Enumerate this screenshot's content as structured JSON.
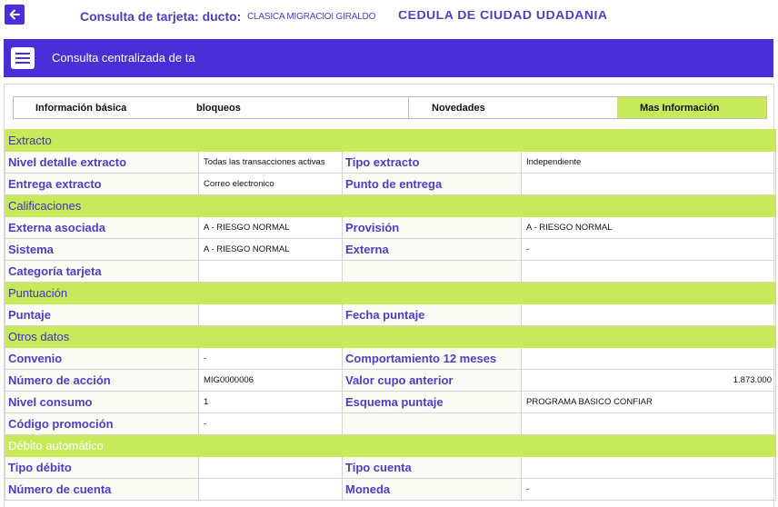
{
  "topbar": {
    "title": "Consulta de tarjeta: ducto:",
    "product": "CLASICA MIGRACIOI GIRALDO",
    "document": "CEDULA DE CIUDAD UDADANIA"
  },
  "banner": {
    "title": "Consulta centralizada de ta"
  },
  "tabs": {
    "basic": "Información básica",
    "bloqueos": "bloqueos",
    "novedades": "Novedades",
    "mas": "Mas Información",
    "active_color": "#c8ea5a"
  },
  "colors": {
    "accent": "#4a2fd6",
    "section": "#c8ea5a",
    "label": "#4a3fc8"
  },
  "sections": {
    "extracto": {
      "title": "Extracto",
      "nivel_label": "Nivel detalle extracto",
      "nivel_value": "Todas las transacciones activas",
      "tipo_label": "Tipo extracto",
      "tipo_value": "Independiente",
      "entrega_label": "Entrega extracto",
      "entrega_value": "Correo electronico",
      "punto_label": "Punto de entrega",
      "punto_value": ""
    },
    "calificaciones": {
      "title": "Calificaciones",
      "externa_asoc_label": "Externa asociada",
      "externa_asoc_value": "A - RIESGO NORMAL",
      "provision_label": "Provisión",
      "provision_value": "A - RIESGO NORMAL",
      "sistema_label": "Sistema",
      "sistema_value": "A - RIESGO NORMAL",
      "externa_label": "Externa",
      "externa_value": "-",
      "categoria_label": "Categoría tarjeta",
      "categoria_value": ""
    },
    "puntuacion": {
      "title": "Puntuación",
      "puntaje_label": "Puntaje",
      "puntaje_value": "",
      "fecha_label": "Fecha puntaje",
      "fecha_value": ""
    },
    "otros": {
      "title": "Otros datos",
      "convenio_label": "Convenio",
      "convenio_value": "-",
      "comport_label": "Comportamiento 12 meses",
      "comport_value": "",
      "accion_label": "Número de acción",
      "accion_value": "MIG0000006",
      "cupo_label": "Valor cupo anterior",
      "cupo_value": "1.873.000",
      "consumo_label": "Nivel consumo",
      "consumo_value": "1",
      "esquema_label": "Esquema puntaje",
      "esquema_value": "PROGRAMA BASICO CONFIAR",
      "promo_label": "Código promoción",
      "promo_value": "-"
    },
    "debito": {
      "title": "Débito automático",
      "tipo_debito_label": "Tipo débito",
      "tipo_debito_value": "",
      "tipo_cuenta_label": "Tipo cuenta",
      "tipo_cuenta_value": "",
      "numero_label": "Número de cuenta",
      "numero_value": "",
      "moneda_label": "Moneda",
      "moneda_value": "-"
    }
  }
}
